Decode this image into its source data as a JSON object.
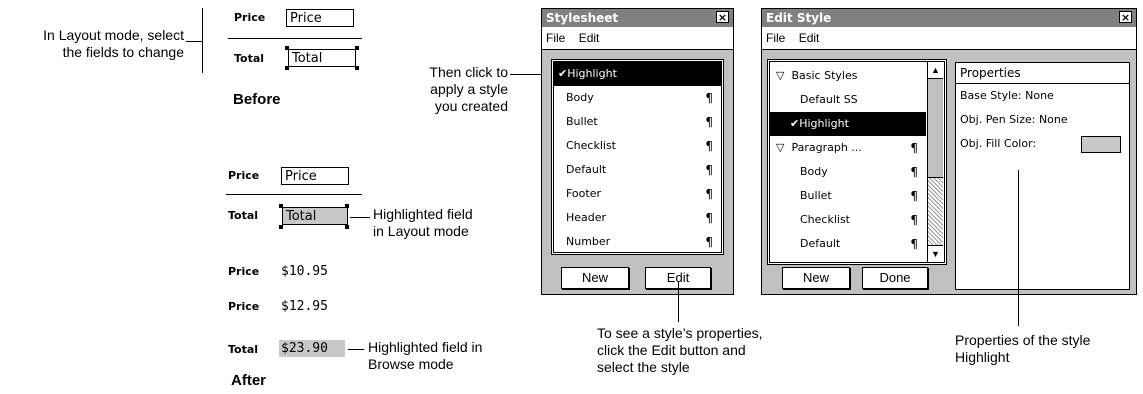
{
  "callouts": {
    "layout_select": [
      "In Layout mode, select",
      "the fields to change"
    ],
    "before": "Before",
    "then_click": [
      "Then click to",
      "apply a style",
      "you created"
    ],
    "highlighted_layout": [
      "Highlighted field",
      "in Layout mode"
    ],
    "highlighted_browse": [
      "Highlighted field in",
      "Browse mode"
    ],
    "after": "After",
    "see_properties": [
      "To see a style’s properties,",
      "click the Edit button and",
      "select the style"
    ],
    "properties_of": [
      "Properties of the style",
      "Highlight"
    ]
  },
  "before_fields": {
    "price_label": "Price",
    "price_value": "Price",
    "total_label": "Total",
    "total_value": "Total"
  },
  "after_layout": {
    "price_label": "Price",
    "price_value": "Price",
    "total_label": "Total",
    "total_value": "Total"
  },
  "browse": {
    "rows": [
      {
        "label": "Price",
        "value": "$10.95",
        "highlighted": false
      },
      {
        "label": "Price",
        "value": "$12.95",
        "highlighted": false
      },
      {
        "label": "Total",
        "value": "$23.90",
        "highlighted": true
      }
    ]
  },
  "stylesheet_window": {
    "title": "Stylesheet",
    "close": "×",
    "menu": [
      "File",
      "Edit"
    ],
    "items": [
      {
        "label": "Highlight",
        "selected": true,
        "check": "✔",
        "pilcrow": ""
      },
      {
        "label": "Body",
        "selected": false,
        "check": "",
        "pilcrow": "¶"
      },
      {
        "label": "Bullet",
        "selected": false,
        "check": "",
        "pilcrow": "¶"
      },
      {
        "label": "Checklist",
        "selected": false,
        "check": "",
        "pilcrow": "¶"
      },
      {
        "label": "Default",
        "selected": false,
        "check": "",
        "pilcrow": "¶"
      },
      {
        "label": "Footer",
        "selected": false,
        "check": "",
        "pilcrow": "¶"
      },
      {
        "label": "Header",
        "selected": false,
        "check": "",
        "pilcrow": "¶"
      },
      {
        "label": "Number",
        "selected": false,
        "check": "",
        "pilcrow": "¶"
      }
    ],
    "buttons": {
      "new": "New",
      "edit": "Edit"
    }
  },
  "edit_style_window": {
    "title": "Edit Style",
    "close": "×",
    "menu": [
      "File",
      "Edit"
    ],
    "tree": [
      {
        "label": "Basic Styles",
        "prefix": "▽",
        "selected": false,
        "pilcrow": "",
        "indent": 0
      },
      {
        "label": "Default SS",
        "prefix": "",
        "selected": false,
        "pilcrow": "",
        "indent": 1
      },
      {
        "label": "Highlight",
        "prefix": "✔",
        "selected": true,
        "pilcrow": "",
        "indent": 1
      },
      {
        "label": "Paragraph ...",
        "prefix": "▽",
        "selected": false,
        "pilcrow": "¶",
        "indent": 0
      },
      {
        "label": "Body",
        "prefix": "",
        "selected": false,
        "pilcrow": "¶",
        "indent": 1
      },
      {
        "label": "Bullet",
        "prefix": "",
        "selected": false,
        "pilcrow": "¶",
        "indent": 1
      },
      {
        "label": "Checklist",
        "prefix": "",
        "selected": false,
        "pilcrow": "¶",
        "indent": 1
      },
      {
        "label": "Default",
        "prefix": "",
        "selected": false,
        "pilcrow": "¶",
        "indent": 1
      }
    ],
    "scroll_up": "▲",
    "scroll_down": "▼",
    "buttons": {
      "new": "New",
      "done": "Done"
    },
    "properties": {
      "header": "Properties",
      "base_style": "Base Style: None",
      "pen_size": "Obj. Pen Size: None",
      "fill_color": "Obj. Fill Color:",
      "fill_swatch": "#c8c8c8"
    }
  }
}
